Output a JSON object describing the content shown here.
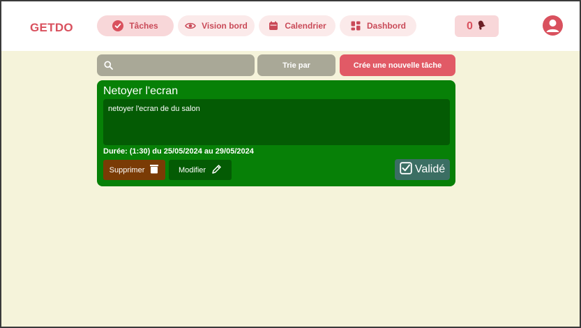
{
  "header": {
    "logo": "GETDO",
    "nav": [
      {
        "label": "Tâches",
        "icon": "check-circle-icon",
        "active": true
      },
      {
        "label": "Vision bord",
        "icon": "eye-icon",
        "active": false
      },
      {
        "label": "Calendrier",
        "icon": "calendar-icon",
        "active": false
      },
      {
        "label": "Dashbord",
        "icon": "dashboard-icon",
        "active": false
      }
    ],
    "notifications": {
      "count": "0",
      "icon": "bell-icon"
    },
    "avatar_icon": "user-icon"
  },
  "toolbar": {
    "search_placeholder": "",
    "search_value": "",
    "sort_label": "Trie par",
    "new_task_label": "Crée une nouvelle tâche"
  },
  "task": {
    "title": "Netoyer l'ecran",
    "description": "netoyer l'ecran de du salon",
    "duration": "Durée: (1:30) du 25/05/2024 au 29/05/2024",
    "delete_label": "Supprimer",
    "edit_label": "Modifier",
    "validate_label": "Validé"
  },
  "colors": {
    "brand": "#d9515e",
    "page_bg": "#f5f3da",
    "card_bg": "#078007",
    "card_desc_bg": "#045b04",
    "delete_bg": "#7a3b05",
    "validate_bg": "#3b6e63",
    "toolbar_grey": "#a9a897"
  }
}
